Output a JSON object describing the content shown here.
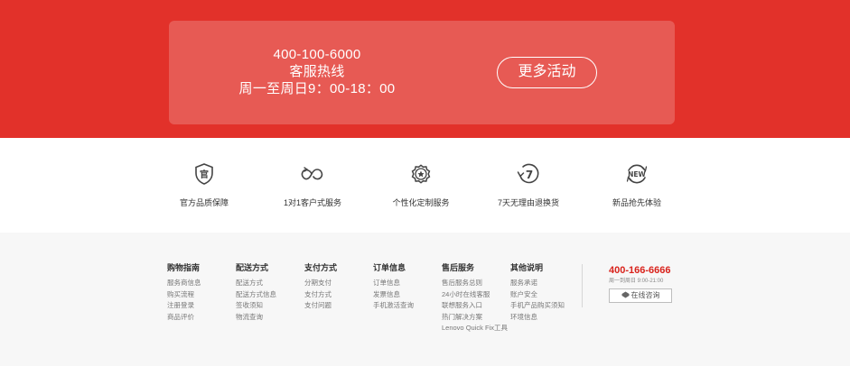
{
  "hero": {
    "phone": "400-100-6000",
    "label": "客服热线",
    "hours": "周一至周日9：00-18：00",
    "more_button": "更多活动"
  },
  "features": [
    {
      "icon": "official-badge-icon",
      "label": "官方品质保障"
    },
    {
      "icon": "one-to-one-service-icon",
      "label": "1对1客户式服务"
    },
    {
      "icon": "custom-badge-icon",
      "label": "个性化定制服务"
    },
    {
      "icon": "seven-day-return-icon",
      "label": "7天无理由退换货"
    },
    {
      "icon": "new-product-icon",
      "label": "新品抢先体验"
    }
  ],
  "footer": {
    "columns": [
      {
        "title": "购物指南",
        "links": [
          "服务商信息",
          "购买流程",
          "注册登录",
          "商品评价"
        ]
      },
      {
        "title": "配送方式",
        "links": [
          "配送方式",
          "配送方式信息",
          "签收须知",
          "物流查询"
        ]
      },
      {
        "title": "支付方式",
        "links": [
          "分期支付",
          "支付方式",
          "支付问题"
        ]
      },
      {
        "title": "订单信息",
        "links": [
          "订单信息",
          "发票信息",
          "手机激活查询"
        ]
      },
      {
        "title": "售后服务",
        "links": [
          "售后服务总则",
          "24小时在线客服",
          "联想服务入口",
          "热门解决方案",
          "Lenovo Quick Fix工具"
        ]
      },
      {
        "title": "其他说明",
        "links": [
          "服务承诺",
          "账户安全",
          "手机产品购买须知",
          "环境信息"
        ]
      }
    ],
    "contact": {
      "phone": "400-166-6666",
      "hours": "周一到周日 9:00-21:00",
      "chat_button": "在线咨询"
    }
  }
}
